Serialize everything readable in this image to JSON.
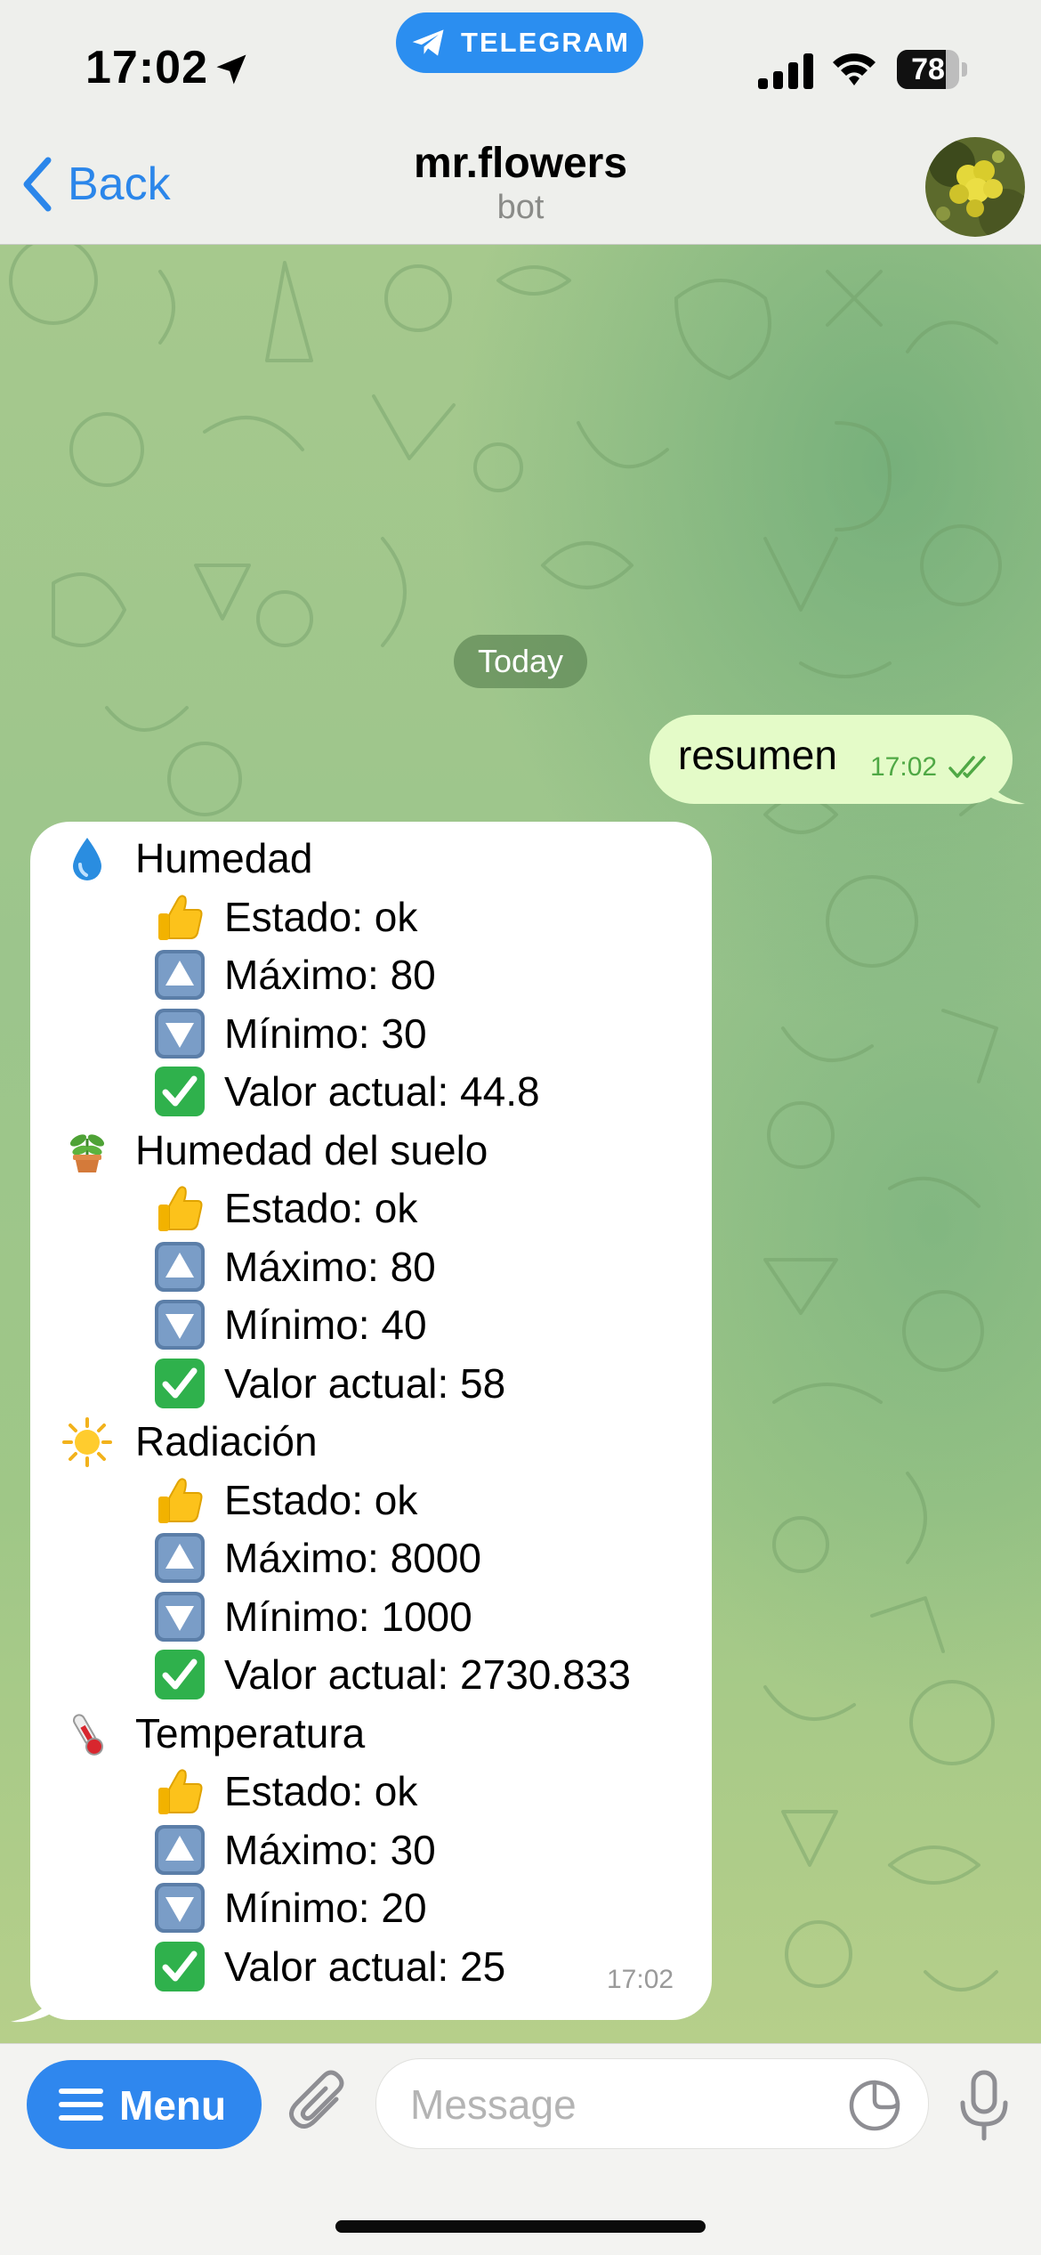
{
  "status_bar": {
    "time": "17:02",
    "telegram_label": "TELEGRAM",
    "battery_percent": "78",
    "battery_level": 0.78
  },
  "header": {
    "back_label": "Back",
    "title": "mr.flowers",
    "subtitle": "bot"
  },
  "chat": {
    "date_separator": "Today",
    "outgoing": {
      "text": "resumen",
      "time": "17:02",
      "status": "read"
    },
    "incoming": {
      "time": "17:02",
      "sections": [
        {
          "icon": "droplet-icon",
          "title": "Humedad",
          "lines": [
            {
              "icon": "thumbs-up-icon",
              "text": "Estado: ok"
            },
            {
              "icon": "up-arrow-icon",
              "text": "Máximo: 80"
            },
            {
              "icon": "down-arrow-icon",
              "text": "Mínimo: 30"
            },
            {
              "icon": "check-mark-icon",
              "text": "Valor actual: 44.8"
            }
          ]
        },
        {
          "icon": "potted-plant-icon",
          "title": "Humedad del suelo",
          "lines": [
            {
              "icon": "thumbs-up-icon",
              "text": "Estado: ok"
            },
            {
              "icon": "up-arrow-icon",
              "text": "Máximo: 80"
            },
            {
              "icon": "down-arrow-icon",
              "text": "Mínimo: 40"
            },
            {
              "icon": "check-mark-icon",
              "text": "Valor actual: 58"
            }
          ]
        },
        {
          "icon": "sun-icon",
          "title": "Radiación",
          "lines": [
            {
              "icon": "thumbs-up-icon",
              "text": "Estado: ok"
            },
            {
              "icon": "up-arrow-icon",
              "text": "Máximo: 8000"
            },
            {
              "icon": "down-arrow-icon",
              "text": "Mínimo: 1000"
            },
            {
              "icon": "check-mark-icon",
              "text": "Valor actual: 2730.833"
            }
          ]
        },
        {
          "icon": "thermometer-icon",
          "title": "Temperatura",
          "lines": [
            {
              "icon": "thumbs-up-icon",
              "text": "Estado: ok"
            },
            {
              "icon": "up-arrow-icon",
              "text": "Máximo: 30"
            },
            {
              "icon": "down-arrow-icon",
              "text": "Mínimo: 20"
            },
            {
              "icon": "check-mark-icon",
              "text": "Valor actual: 25"
            }
          ]
        }
      ]
    }
  },
  "input_bar": {
    "menu_label": "Menu",
    "placeholder": "Message"
  },
  "colors": {
    "accent": "#2b86ea",
    "outgoing_bubble": "#e4fbc8",
    "incoming_bubble": "#ffffff",
    "read_check": "#4fa845"
  }
}
